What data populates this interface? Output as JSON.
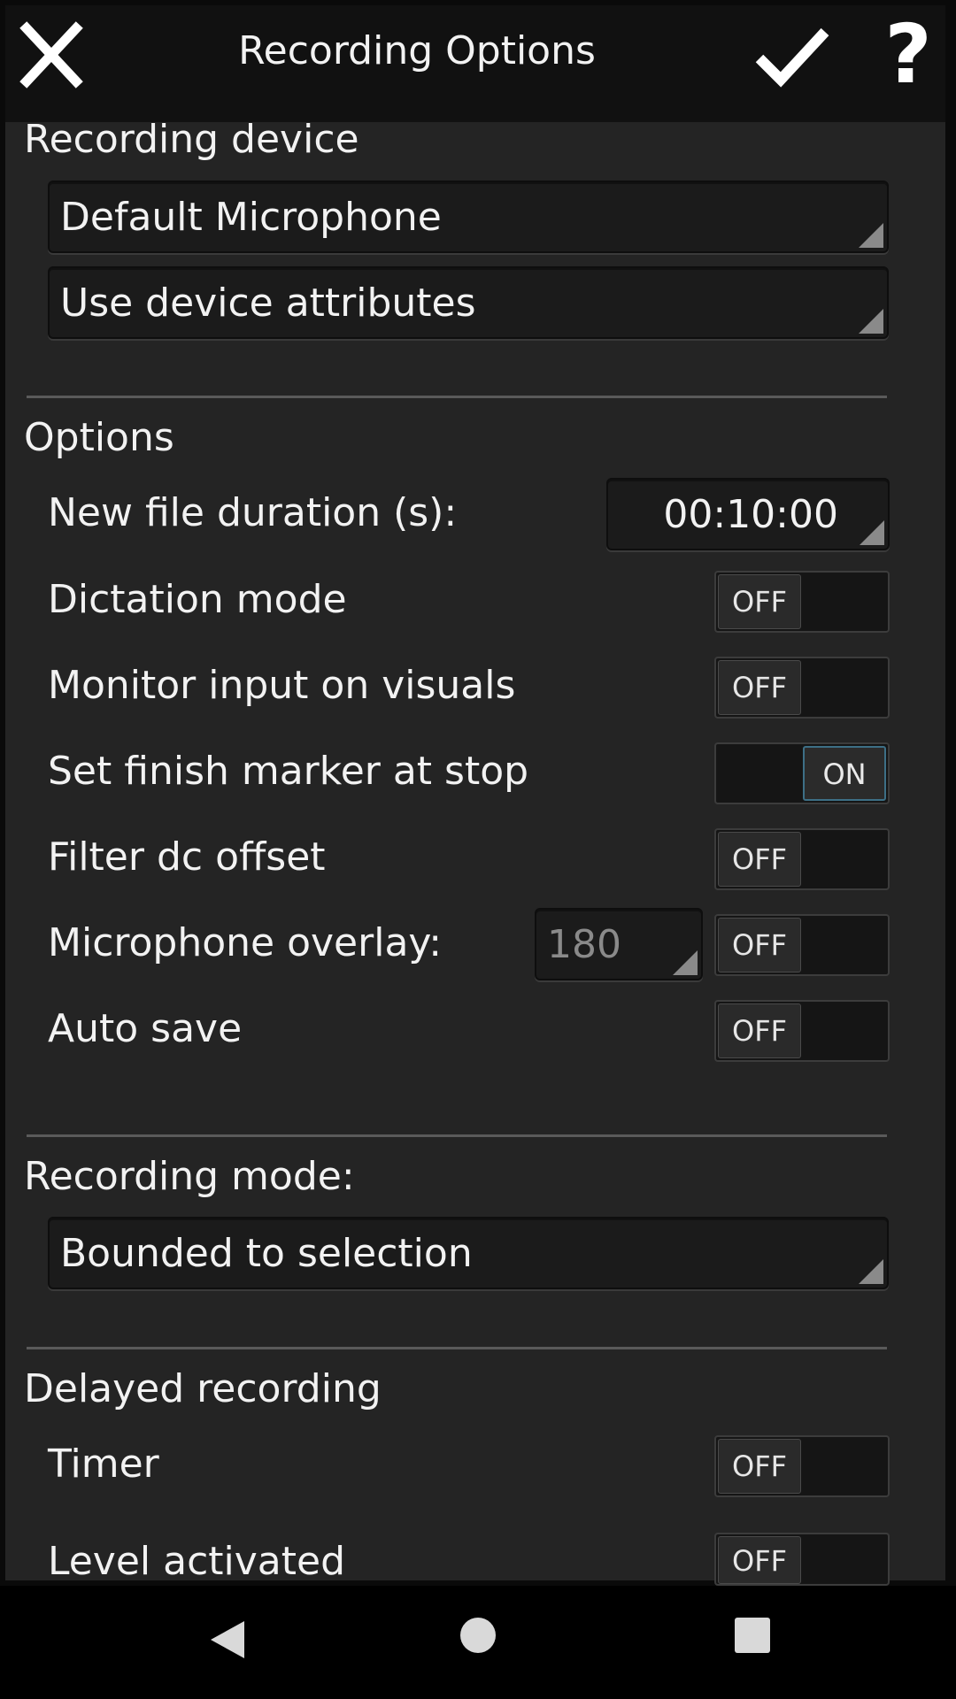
{
  "header": {
    "title": "Recording Options",
    "help_label": "?"
  },
  "recording_device": {
    "section_title": "Recording device",
    "device": "Default Microphone",
    "attributes": "Use device attributes"
  },
  "options": {
    "section_title": "Options",
    "new_file_duration_label": "New file duration (s):",
    "new_file_duration_value": "00:10:00",
    "dictation_mode_label": "Dictation mode",
    "dictation_mode_state": "OFF",
    "monitor_input_label": "Monitor input on visuals",
    "monitor_input_state": "OFF",
    "finish_marker_label": "Set finish marker at stop",
    "finish_marker_state": "ON",
    "filter_dc_label": "Filter dc offset",
    "filter_dc_state": "OFF",
    "mic_overlay_label": "Microphone overlay:",
    "mic_overlay_value": "180",
    "mic_overlay_state": "OFF",
    "auto_save_label": "Auto save",
    "auto_save_state": "OFF"
  },
  "recording_mode": {
    "section_title": "Recording  mode:",
    "value": "Bounded to selection"
  },
  "delayed_recording": {
    "section_title": "Delayed recording",
    "timer_label": "Timer",
    "timer_state": "OFF",
    "level_activated_label": "Level activated",
    "level_activated_state": "OFF"
  },
  "colors": {
    "background": "#242424",
    "header": "#111111",
    "on_accent": "#3d6f86"
  }
}
